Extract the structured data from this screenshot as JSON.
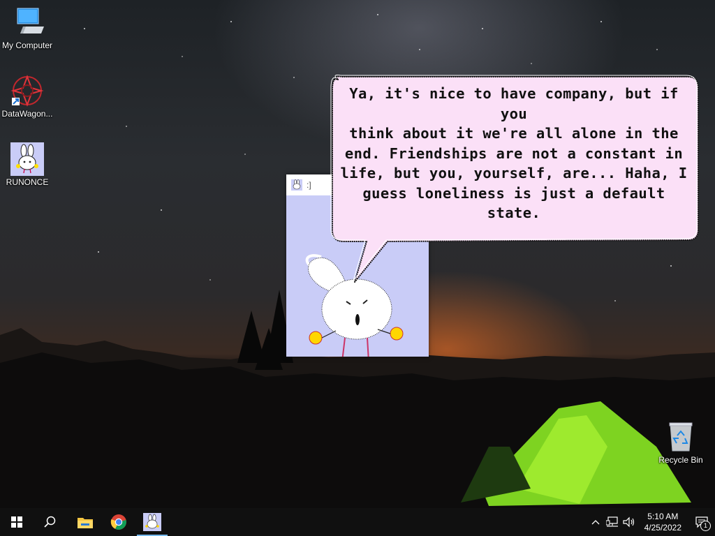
{
  "desktop": {
    "icons": [
      {
        "label": "My Computer",
        "icon": "computer-icon"
      },
      {
        "label": "DataWagon...",
        "icon": "datawagon-icon"
      },
      {
        "label": "RUNONCE",
        "icon": "runonce-icon"
      },
      {
        "label": "Recycle Bin",
        "icon": "recycle-bin-icon"
      }
    ]
  },
  "app_window": {
    "title": ":]",
    "icon": "bunny-icon"
  },
  "speech_bubble": {
    "lines": [
      "Ya, it's nice to have company, but if you",
      "think about it we're all alone in the",
      "end. Friendships are not a constant in",
      "life, but you, yourself, are... Haha, I",
      "guess loneliness is just a default state."
    ]
  },
  "taskbar": {
    "buttons": [
      {
        "name": "start",
        "icon": "windows-start-icon"
      },
      {
        "name": "search",
        "icon": "search-icon"
      },
      {
        "name": "file-explorer",
        "icon": "folder-icon"
      },
      {
        "name": "chrome",
        "icon": "chrome-icon"
      },
      {
        "name": "bunny-app",
        "icon": "bunny-icon",
        "active": true
      }
    ],
    "tray": {
      "time": "5:10 AM",
      "date": "4/25/2022",
      "notification_count": "1"
    }
  },
  "colors": {
    "bubble_fill": "#fbe0f7",
    "app_bg": "#c9ccf7",
    "taskbar_bg": "#101010",
    "active_indicator": "#76b9ed"
  }
}
